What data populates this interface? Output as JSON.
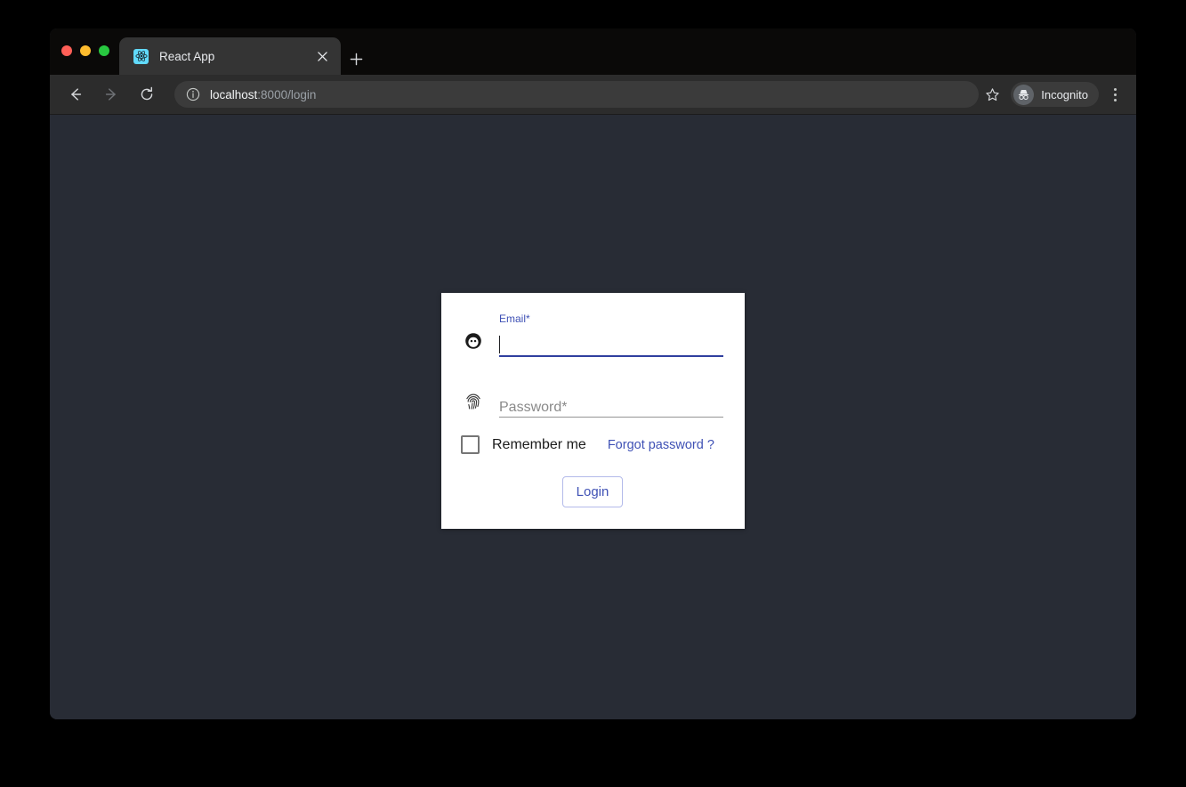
{
  "browser": {
    "traffic_lights": [
      "close",
      "minimize",
      "maximize"
    ],
    "tab": {
      "title": "React App",
      "favicon_name": "react-logo-icon",
      "favicon_color": "#61dafb",
      "close_label": "×"
    },
    "new_tab_label": "+",
    "toolbar": {
      "back_label": "←",
      "forward_label": "→",
      "reload_label": "⟳",
      "site_info_icon": "info-circle-icon",
      "url_host": "localhost",
      "url_path": ":8000/login",
      "bookmark_icon": "star-outline-icon",
      "profile_label": "Incognito",
      "profile_icon": "incognito-hat-icon",
      "menu_icon": "three-dots-vertical-icon"
    }
  },
  "page": {
    "background_color": "#282c35",
    "card": {
      "background_color": "#ffffff",
      "email": {
        "icon_name": "account-face-icon",
        "label": "Email",
        "required_mark": "*",
        "value": "",
        "focused": true,
        "accent_color": "#303f9f"
      },
      "password": {
        "icon_name": "fingerprint-icon",
        "placeholder": "Password",
        "required_mark": "*",
        "value": "",
        "focused": false,
        "line_color": "#949494"
      },
      "remember": {
        "checked": false,
        "label": "Remember me"
      },
      "forgot_link": {
        "label": "Forgot password ?",
        "color": "#3f51b5"
      },
      "login_button": {
        "label": "Login",
        "text_color": "#3f51b5",
        "border_color": "#b3baea"
      }
    }
  }
}
